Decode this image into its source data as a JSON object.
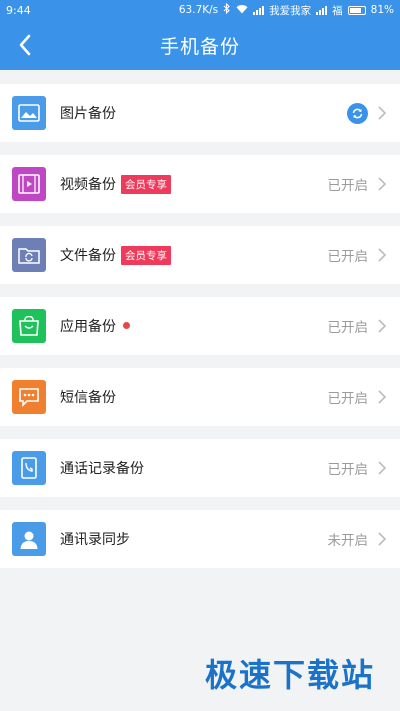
{
  "status_bar": {
    "time": "9:44",
    "speed": "63.7K/s",
    "carrier1": "我爱我家",
    "carrier2": "福",
    "battery": "81%",
    "battery_level": 0.81
  },
  "header": {
    "title": "手机备份"
  },
  "items": [
    {
      "label": "图片备份",
      "status": "",
      "badge": "",
      "icon": "image-icon",
      "color": "#4a9be8"
    },
    {
      "label": "视频备份",
      "status": "已开启",
      "badge": "会员专享",
      "icon": "video-icon",
      "color": "#c047c3"
    },
    {
      "label": "文件备份",
      "status": "已开启",
      "badge": "会员专享",
      "icon": "folder-sync-icon",
      "color": "#6e7fb8"
    },
    {
      "label": "应用备份",
      "status": "已开启",
      "badge": "",
      "icon": "shopping-bag-icon",
      "color": "#1fc25a"
    },
    {
      "label": "短信备份",
      "status": "已开启",
      "badge": "",
      "icon": "message-icon",
      "color": "#f08030"
    },
    {
      "label": "通话记录备份",
      "status": "已开启",
      "badge": "",
      "icon": "phone-record-icon",
      "color": "#4a9be8"
    },
    {
      "label": "通讯录同步",
      "status": "未开启",
      "badge": "",
      "icon": "contact-icon",
      "color": "#4a9be8"
    }
  ],
  "watermark": "极速下载站"
}
